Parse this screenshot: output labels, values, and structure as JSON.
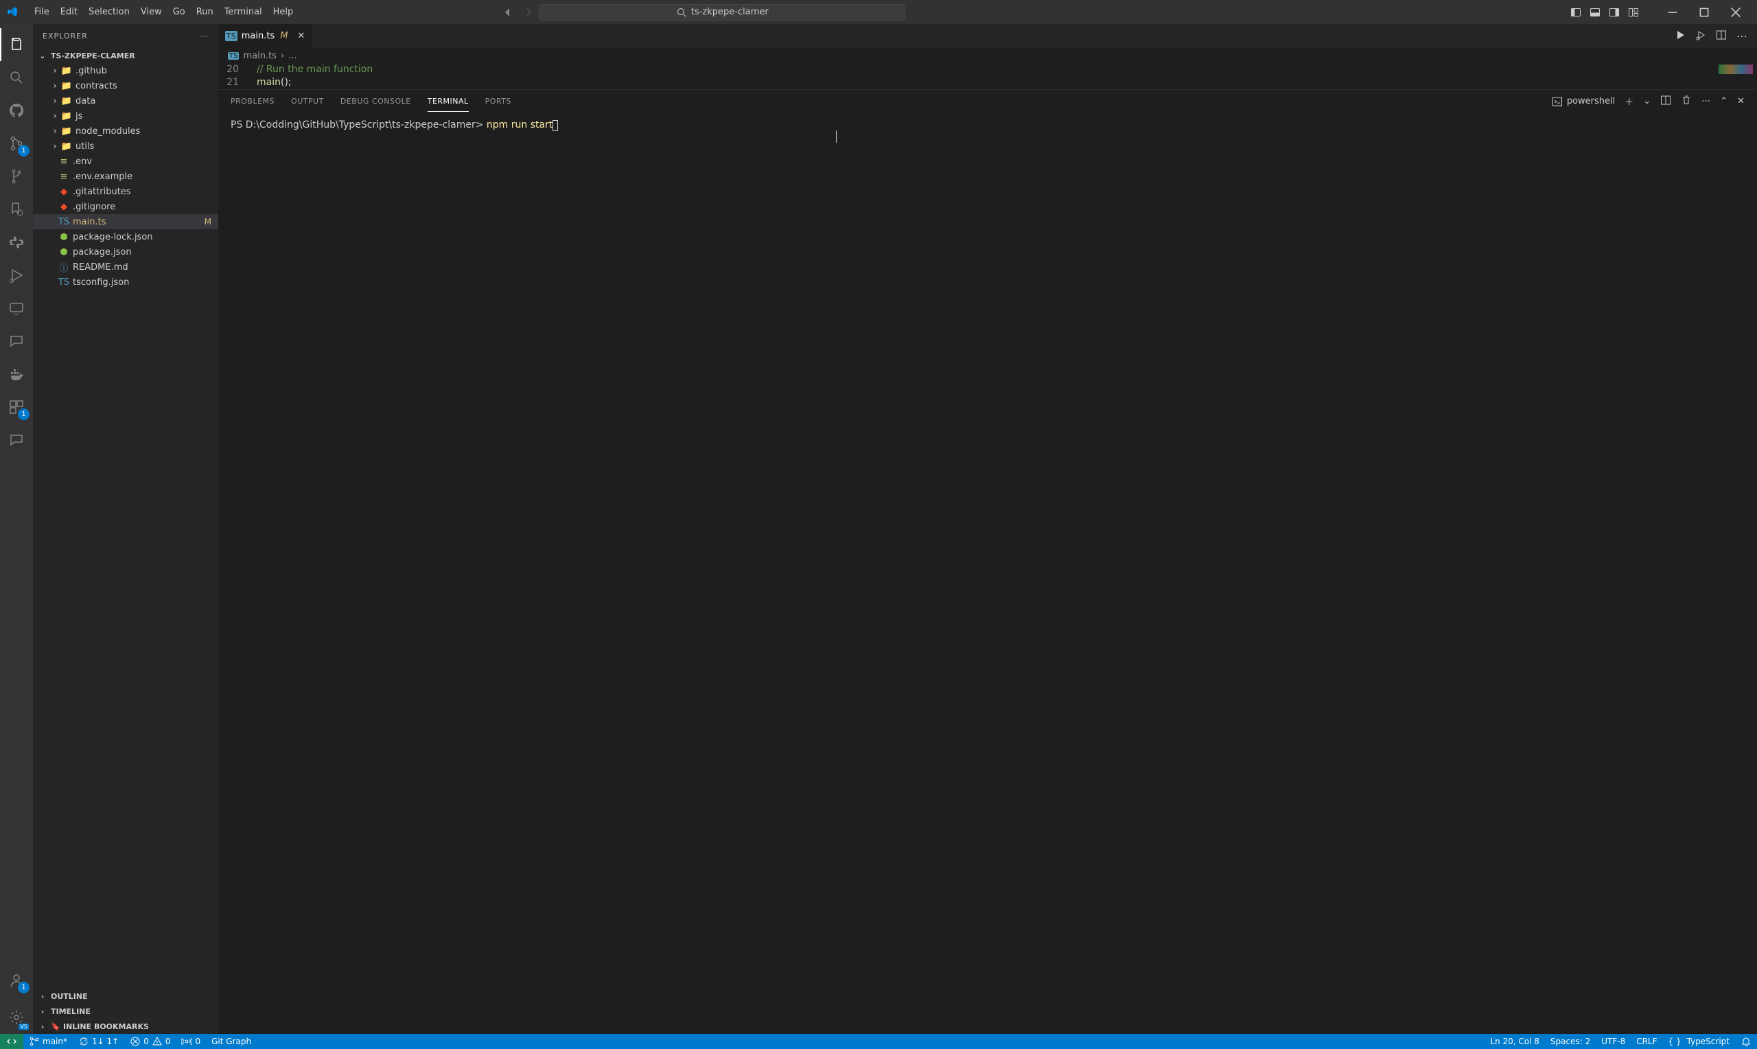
{
  "title": {
    "project": "ts-zkpepe-clamer"
  },
  "menu": {
    "items": [
      "File",
      "Edit",
      "Selection",
      "View",
      "Go",
      "Run",
      "Terminal",
      "Help"
    ]
  },
  "sidebar": {
    "title": "EXPLORER",
    "project": "TS-ZKPEPE-CLAMER",
    "folders": [
      {
        "name": ".github",
        "icon": "folder-github"
      },
      {
        "name": "contracts",
        "icon": "folder"
      },
      {
        "name": "data",
        "icon": "folder"
      },
      {
        "name": "js",
        "icon": "folder"
      },
      {
        "name": "node_modules",
        "icon": "folder"
      },
      {
        "name": "utils",
        "icon": "folder"
      }
    ],
    "files": [
      {
        "name": ".env",
        "icon": "env"
      },
      {
        "name": ".env.example",
        "icon": "env"
      },
      {
        "name": ".gitattributes",
        "icon": "git"
      },
      {
        "name": ".gitignore",
        "icon": "git"
      },
      {
        "name": "main.ts",
        "icon": "ts",
        "status": "M",
        "selected": true
      },
      {
        "name": "package-lock.json",
        "icon": "pkg"
      },
      {
        "name": "package.json",
        "icon": "pkg"
      },
      {
        "name": "README.md",
        "icon": "md"
      },
      {
        "name": "tsconfig.json",
        "icon": "ts"
      }
    ],
    "sections": {
      "outline": "OUTLINE",
      "timeline": "TIMELINE",
      "bookmarks": "INLINE BOOKMARKS"
    }
  },
  "activity": {
    "scm_badge": "1",
    "ext_badge": "1",
    "acct_badge": "1"
  },
  "tabs": {
    "open": [
      {
        "name": "main.ts",
        "mod": "M",
        "active": true
      }
    ]
  },
  "breadcrumb": {
    "file": "main.ts",
    "tail": "..."
  },
  "editor": {
    "lines": [
      {
        "num": "20",
        "html": "comment",
        "text": "// Run the main function"
      },
      {
        "num": "21",
        "html": "code",
        "text": "main();"
      }
    ]
  },
  "panel": {
    "tabs": {
      "problems": "PROBLEMS",
      "output": "OUTPUT",
      "debug": "DEBUG CONSOLE",
      "terminal": "TERMINAL",
      "ports": "PORTS"
    },
    "shell_name": "powershell",
    "terminal_prompt": "PS D:\\Codding\\GitHub\\TypeScript\\ts-zkpepe-clamer> ",
    "terminal_cmd": "npm run start"
  },
  "status": {
    "branch": "main*",
    "sync": "1↓ 1↑",
    "errors": "0",
    "warnings": "0",
    "radio": "0",
    "gitgraph": "Git Graph",
    "cursor": "Ln 20, Col 8",
    "spaces": "Spaces: 2",
    "encoding": "UTF-8",
    "eol": "CRLF",
    "lang": "TypeScript"
  }
}
